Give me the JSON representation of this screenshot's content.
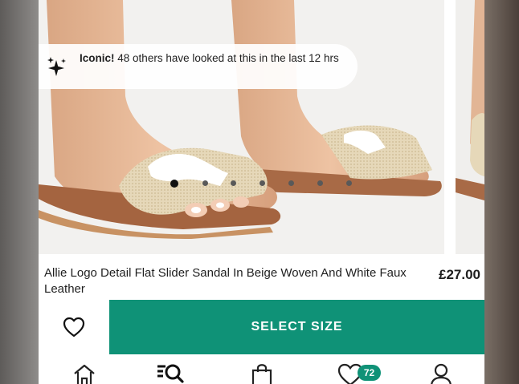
{
  "product_gallery": {
    "image_label": "beige woven flat slider sandal with white faux leather logo",
    "popularity": {
      "highlight": "Iconic!",
      "message": "48 others have looked at this in the last 12 hrs"
    },
    "pagination": {
      "total": 7,
      "current": 1
    }
  },
  "product": {
    "title": "Allie Logo Detail Flat Slider Sandal In Beige Woven And White Faux Leather",
    "price": "£27.00"
  },
  "actions": {
    "wishlist_icon": "heart-outline-icon",
    "select_size_label": "SELECT SIZE"
  },
  "bottom_nav": {
    "items": [
      {
        "icon": "home-icon"
      },
      {
        "icon": "search-icon",
        "active": true
      },
      {
        "icon": "bag-icon"
      },
      {
        "icon": "heart-icon",
        "badge": "72"
      },
      {
        "icon": "account-icon"
      }
    ]
  },
  "colors": {
    "accent": "#0f9277",
    "text": "#1f1f1f",
    "page": "#ffffff"
  }
}
